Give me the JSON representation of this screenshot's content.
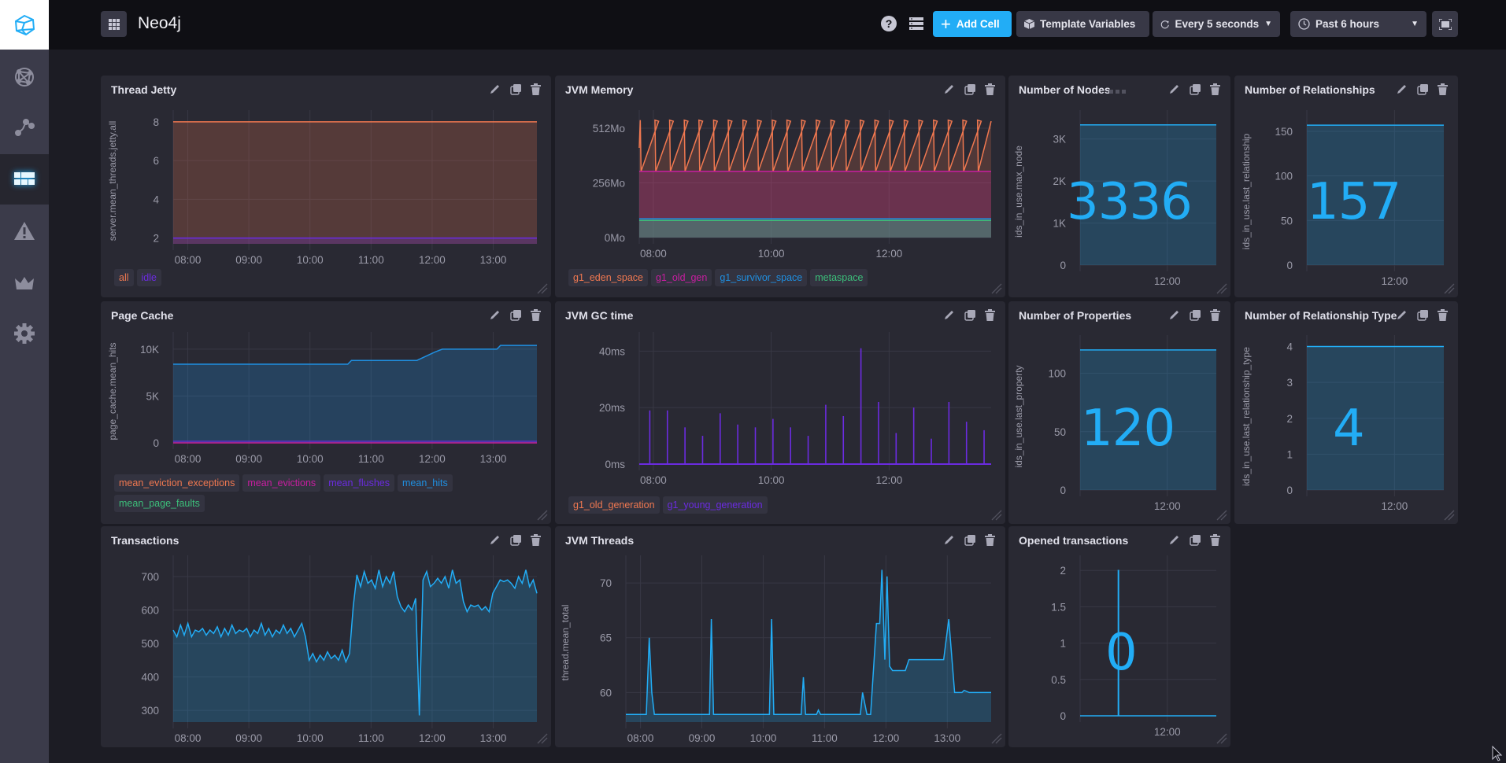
{
  "header": {
    "title": "Neo4j",
    "add_cell_label": "Add Cell",
    "template_variables_label": "Template Variables",
    "refresh_label": "Every 5 seconds",
    "time_range_label": "Past 6 hours"
  },
  "sidebar": {
    "items": [
      {
        "name": "data-explorer",
        "icon": "graph-icon"
      },
      {
        "name": "host-list",
        "icon": "node-graph-icon"
      },
      {
        "name": "dashboards",
        "icon": "dashboard-icon",
        "active": true
      },
      {
        "name": "alerts",
        "icon": "warning-icon"
      },
      {
        "name": "admin",
        "icon": "crown-icon"
      },
      {
        "name": "configuration",
        "icon": "gear-icon"
      }
    ]
  },
  "colors": {
    "accent": "#22adf6",
    "orange": "#f07850",
    "magenta": "#c81ea0",
    "purple": "#6b2be0",
    "blue": "#1f8fe0",
    "green": "#3cbf7a",
    "panel": "#292933"
  },
  "panels": {
    "thread_jetty": {
      "title": "Thread Jetty",
      "legend": [
        "all",
        "idle"
      ]
    },
    "jvm_memory": {
      "title": "JVM Memory",
      "legend": [
        "g1_eden_space",
        "g1_old_gen",
        "g1_survivor_space",
        "metaspace"
      ]
    },
    "nodes": {
      "title": "Number of Nodes",
      "value": "3336"
    },
    "relationships": {
      "title": "Number of Relationships",
      "value": "157"
    },
    "page_cache": {
      "title": "Page Cache",
      "legend": [
        "mean_eviction_exceptions",
        "mean_evictions",
        "mean_flushes",
        "mean_hits",
        "mean_page_faults"
      ]
    },
    "gc_time": {
      "title": "JVM GC time",
      "legend": [
        "g1_old_generation",
        "g1_young_generation"
      ]
    },
    "properties": {
      "title": "Number of Properties",
      "value": "120"
    },
    "relationship_types": {
      "title": "Number of Relationship Type",
      "value": "4"
    },
    "transactions": {
      "title": "Transactions"
    },
    "jvm_threads": {
      "title": "JVM Threads"
    },
    "opened_transactions": {
      "title": "Opened transactions",
      "value": "0"
    }
  },
  "chart_data": [
    {
      "id": "thread_jetty",
      "type": "area",
      "title": "Thread Jetty",
      "ylabel": "server.mean_threads.jetty.all",
      "x": [
        "07:50",
        "13:45"
      ],
      "xticks": [
        "08:00",
        "09:00",
        "10:00",
        "11:00",
        "12:00",
        "13:00"
      ],
      "yticks": [
        "2",
        "4",
        "6",
        "8"
      ],
      "ylim": [
        1.7,
        8.2
      ],
      "series": [
        {
          "name": "all",
          "values": [
            8,
            8
          ]
        },
        {
          "name": "idle",
          "values": [
            2,
            2
          ]
        }
      ]
    },
    {
      "id": "jvm_memory",
      "type": "area",
      "title": "JVM Memory",
      "xticks": [
        "08:00",
        "10:00",
        "12:00"
      ],
      "yticks": [
        "0Mo",
        "256Mo",
        "512Mo"
      ],
      "ylim": [
        0,
        560
      ],
      "series": [
        {
          "name": "metaspace",
          "values": [
            80
          ]
        },
        {
          "name": "g1_survivor_space",
          "values": [
            88
          ]
        },
        {
          "name": "g1_old_gen",
          "values": [
            310
          ]
        },
        {
          "name": "g1_eden_space",
          "values": "sawtooth 310-550, ~24 cycles"
        }
      ]
    },
    {
      "id": "nodes",
      "type": "area",
      "title": "Number of Nodes",
      "ylabel": "ids_in_use.max_node",
      "xticks": [
        "12:00"
      ],
      "yticks": [
        "0",
        "1K",
        "2K",
        "3K"
      ],
      "ylim": [
        0,
        3500
      ],
      "series": [
        {
          "name": "max_node",
          "values": [
            3336,
            3336
          ]
        }
      ]
    },
    {
      "id": "relationships",
      "type": "area",
      "title": "Number of Relationships",
      "ylabel": "ids_in_use.last_relationship",
      "xticks": [
        "12:00"
      ],
      "yticks": [
        "0",
        "50",
        "100",
        "150"
      ],
      "ylim": [
        0,
        165
      ],
      "series": [
        {
          "name": "last_relationship",
          "values": [
            157,
            157
          ]
        }
      ]
    },
    {
      "id": "page_cache",
      "type": "area",
      "title": "Page Cache",
      "ylabel": "page_cache.mean_hits",
      "xticks": [
        "08:00",
        "09:00",
        "10:00",
        "11:00",
        "12:00",
        "13:00"
      ],
      "yticks": [
        "0",
        "5K",
        "10K"
      ],
      "ylim": [
        0,
        11000
      ],
      "series": [
        {
          "name": "mean_hits",
          "points": [
            [
              0,
              8400
            ],
            [
              0.48,
              8400
            ],
            [
              0.49,
              8800
            ],
            [
              0.67,
              8800
            ],
            [
              0.72,
              9700
            ],
            [
              0.74,
              10000
            ],
            [
              0.89,
              10000
            ],
            [
              0.9,
              10400
            ],
            [
              1,
              10400
            ]
          ]
        },
        {
          "name": "mean_evictions",
          "values": [
            0
          ]
        },
        {
          "name": "mean_flushes",
          "values": [
            50
          ]
        }
      ]
    },
    {
      "id": "gc_time",
      "type": "bar",
      "title": "JVM GC time",
      "xticks": [
        "08:00",
        "10:00",
        "12:00"
      ],
      "yticks": [
        "0ms",
        "20ms",
        "40ms"
      ],
      "ylim": [
        0,
        44
      ],
      "series": [
        {
          "name": "g1_young_generation",
          "values": [
            19,
            19,
            13,
            10,
            18,
            14,
            13,
            16,
            13,
            10,
            21,
            17,
            41,
            22,
            11,
            20,
            9,
            22,
            15,
            12
          ]
        }
      ]
    },
    {
      "id": "properties",
      "type": "area",
      "title": "Number of Properties",
      "ylabel": "ids_in_use.last_property",
      "xticks": [
        "12:00"
      ],
      "yticks": [
        "0",
        "50",
        "100"
      ],
      "ylim": [
        0,
        126
      ],
      "series": [
        {
          "name": "last_property",
          "values": [
            120,
            120
          ]
        }
      ]
    },
    {
      "id": "relationship_types",
      "type": "area",
      "title": "Number of Relationship Type",
      "ylabel": "ids_in_use.last_relationship_type",
      "xticks": [
        "12:00"
      ],
      "yticks": [
        "0",
        "1",
        "2",
        "3",
        "4"
      ],
      "ylim": [
        0,
        4.1
      ],
      "series": [
        {
          "name": "last_relationship_type",
          "values": [
            4,
            4
          ]
        }
      ]
    },
    {
      "id": "transactions",
      "type": "area",
      "title": "Transactions",
      "xticks": [
        "08:00",
        "09:00",
        "10:00",
        "11:00",
        "12:00",
        "13:00"
      ],
      "yticks": [
        "300",
        "400",
        "500",
        "600",
        "700"
      ],
      "ylim": [
        265,
        740
      ],
      "series": [
        {
          "name": "transactions",
          "values": [
            540,
            520,
            555,
            525,
            560,
            520,
            540,
            535,
            545,
            525,
            540,
            530,
            550,
            520,
            545,
            525,
            555,
            530,
            540,
            535,
            545,
            520,
            540,
            530,
            560,
            525,
            545,
            520,
            540,
            530,
            555,
            530,
            545,
            520,
            540,
            560,
            520,
            450,
            470,
            445,
            465,
            450,
            475,
            455,
            465,
            450,
            480,
            445,
            470,
            610,
            705,
            670,
            715,
            680,
            690,
            665,
            720,
            670,
            700,
            680,
            715,
            640,
            610,
            595,
            615,
            600,
            635,
            285,
            690,
            715,
            670,
            680,
            695,
            680,
            700,
            665,
            720,
            680,
            690,
            625,
            595,
            615,
            610,
            615,
            600,
            610,
            595,
            650,
            670,
            690,
            685,
            690,
            680,
            665,
            700,
            680,
            720,
            670,
            690,
            650
          ]
        }
      ]
    },
    {
      "id": "jvm_threads",
      "type": "area",
      "title": "JVM Threads",
      "ylabel": "thread.mean_total",
      "xticks": [
        "08:00",
        "09:00",
        "10:00",
        "11:00",
        "12:00",
        "13:00"
      ],
      "yticks": [
        "60",
        "65",
        "70"
      ],
      "ylim": [
        57.3,
        71.8
      ],
      "series": [
        {
          "name": "mean_total",
          "points": [
            [
              0,
              58
            ],
            [
              0.056,
              58
            ],
            [
              0.064,
              65
            ],
            [
              0.071,
              60
            ],
            [
              0.078,
              58
            ],
            [
              0.229,
              58
            ],
            [
              0.234,
              66.7
            ],
            [
              0.24,
              58
            ],
            [
              0.393,
              58
            ],
            [
              0.399,
              66.7
            ],
            [
              0.405,
              58
            ],
            [
              0.48,
              58
            ],
            [
              0.486,
              61.4
            ],
            [
              0.492,
              58
            ],
            [
              0.522,
              58
            ],
            [
              0.527,
              58.4
            ],
            [
              0.533,
              58
            ],
            [
              0.642,
              58
            ],
            [
              0.648,
              60
            ],
            [
              0.66,
              58
            ],
            [
              0.67,
              58
            ],
            [
              0.686,
              66.3
            ],
            [
              0.695,
              66.3
            ],
            [
              0.701,
              71.2
            ],
            [
              0.709,
              63
            ],
            [
              0.715,
              70.6
            ],
            [
              0.722,
              62.4
            ],
            [
              0.73,
              62
            ],
            [
              0.765,
              62
            ],
            [
              0.775,
              63
            ],
            [
              0.87,
              63
            ],
            [
              0.884,
              66.7
            ],
            [
              0.9,
              60
            ],
            [
              0.92,
              60
            ],
            [
              0.926,
              60.2
            ],
            [
              0.94,
              60
            ],
            [
              1,
              60
            ]
          ]
        }
      ]
    },
    {
      "id": "opened_transactions",
      "type": "area",
      "title": "Opened transactions",
      "xticks": [
        "12:00"
      ],
      "yticks": [
        "0",
        "0.5",
        "1",
        "1.5",
        "2"
      ],
      "ylim": [
        0,
        2.1
      ],
      "series": [
        {
          "name": "opened",
          "points": [
            [
              0,
              0
            ],
            [
              0.28,
              0
            ],
            [
              0.28,
              2
            ],
            [
              0.283,
              2
            ],
            [
              0.283,
              0
            ],
            [
              1,
              0
            ]
          ]
        }
      ]
    }
  ]
}
